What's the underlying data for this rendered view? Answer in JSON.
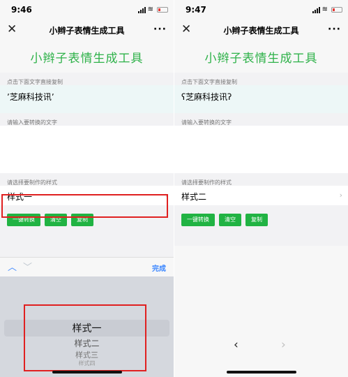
{
  "colors": {
    "accent_green": "#2fb24a",
    "button_green": "#21b343",
    "link_blue": "#3a86ff",
    "highlight_red": "#e02020"
  },
  "left": {
    "status": {
      "time": "9:46"
    },
    "nav": {
      "title": "小辫子表情生成工具",
      "close_icon": "close-icon",
      "more_icon": "more-icon"
    },
    "app_title": "小辫子表情生成工具",
    "output_label": "点击下面文字直接复制",
    "output_text": "ʼ芝麻科技讯ʼ",
    "input_label": "请输入要转换的文字",
    "style_label": "请选择要制作的样式",
    "style_value": "样式一",
    "buttons": {
      "convert": "一键转换",
      "clear": "清空",
      "copy": "复制"
    },
    "picker": {
      "done": "完成",
      "options": [
        "样式一",
        "样式二",
        "样式三",
        "样式四"
      ]
    }
  },
  "right": {
    "status": {
      "time": "9:47"
    },
    "nav": {
      "title": "小辫子表情生成工具"
    },
    "app_title": "小辫子表情生成工具",
    "output_label": "点击下面文字直接复制",
    "output_text": "ʕ芝麻科技讯ʔ",
    "input_label": "请输入要转换的文字",
    "style_label": "请选择要制作的样式",
    "style_value": "样式二",
    "buttons": {
      "convert": "一键转换",
      "clear": "清空",
      "copy": "复制"
    }
  }
}
